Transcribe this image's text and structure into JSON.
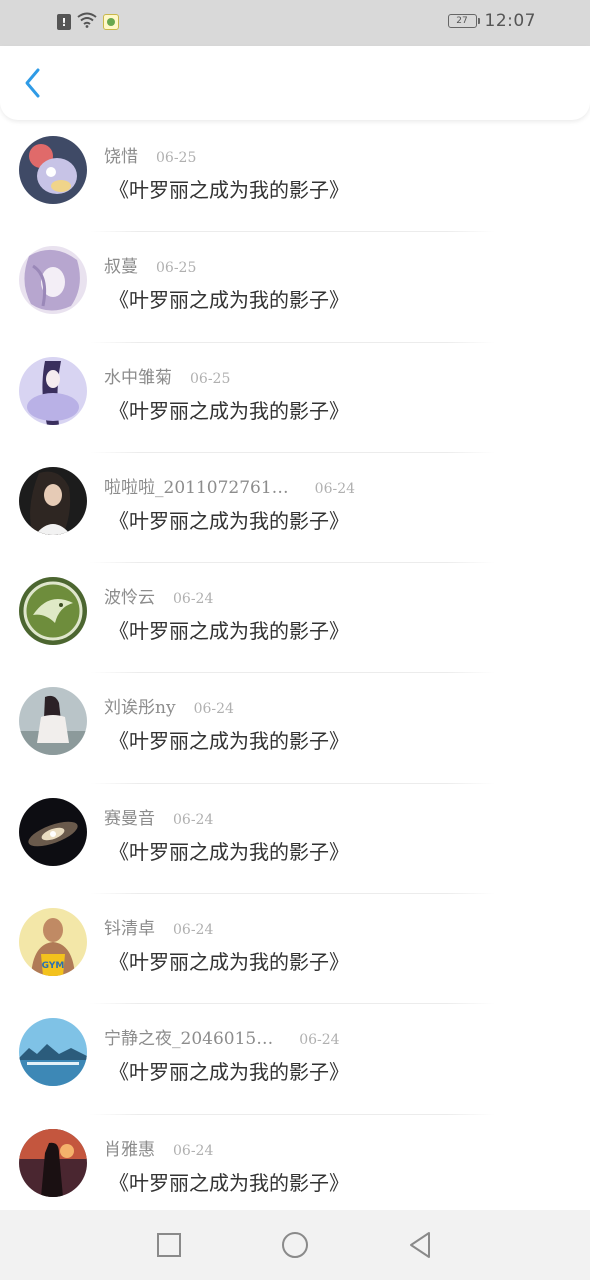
{
  "status_bar": {
    "time": "12:07",
    "battery_level": "27",
    "icons": [
      "alert-icon",
      "wifi-icon",
      "app-notification-icon"
    ]
  },
  "header": {
    "back_icon": "chevron-left-icon",
    "accent_color": "#2f9be6"
  },
  "list": [
    {
      "name": "饶惜",
      "date": "06-25",
      "book": "《叶罗丽之成为我的影子》"
    },
    {
      "name": "叔蔓",
      "date": "06-25",
      "book": "《叶罗丽之成为我的影子》"
    },
    {
      "name": "水中雏菊",
      "date": "06-25",
      "book": "《叶罗丽之成为我的影子》"
    },
    {
      "name": "啦啦啦_2011072761…",
      "date": "06-24",
      "book": "《叶罗丽之成为我的影子》"
    },
    {
      "name": "波怜云",
      "date": "06-24",
      "book": "《叶罗丽之成为我的影子》"
    },
    {
      "name": "刘诶彤ny",
      "date": "06-24",
      "book": "《叶罗丽之成为我的影子》"
    },
    {
      "name": "赛曼音",
      "date": "06-24",
      "book": "《叶罗丽之成为我的影子》"
    },
    {
      "name": "钭清卓",
      "date": "06-24",
      "book": "《叶罗丽之成为我的影子》"
    },
    {
      "name": "宁静之夜_2046015…",
      "date": "06-24",
      "book": "《叶罗丽之成为我的影子》"
    },
    {
      "name": "肖雅惠",
      "date": "06-24",
      "book": "《叶罗丽之成为我的影子》"
    }
  ],
  "nav_bar": {
    "icons": [
      "square-recents-icon",
      "circle-home-icon",
      "triangle-back-icon"
    ]
  }
}
